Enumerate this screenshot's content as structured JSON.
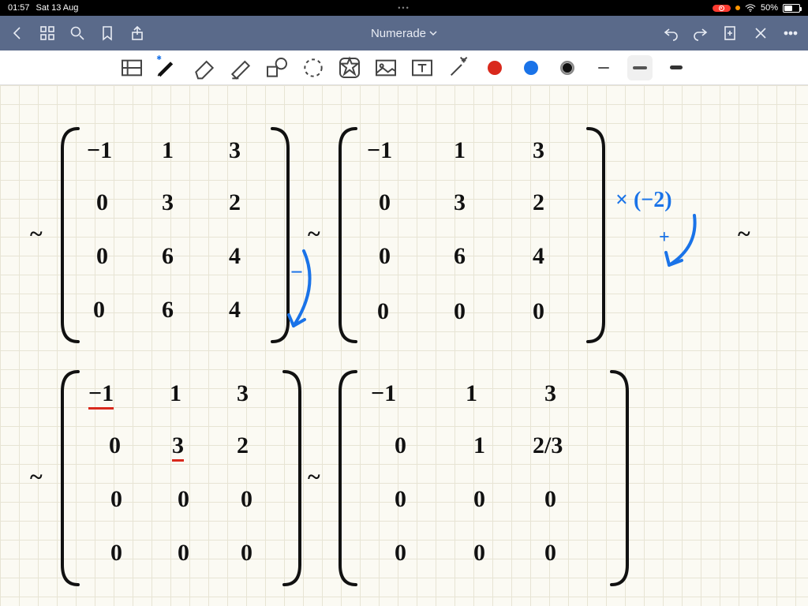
{
  "status": {
    "time": "01:57",
    "date": "Sat 13 Aug",
    "battery_pct": "50%"
  },
  "nav": {
    "title": "Numerade"
  },
  "colors": {
    "red": "#d9291c",
    "blue": "#1a73e8",
    "black": "#111111"
  },
  "work": {
    "tilde": "~",
    "annot1_op": "−",
    "annot2_mult": "× (−2)",
    "annot2_plus": "+",
    "matrix1": [
      [
        "−1",
        "1",
        "3"
      ],
      [
        "0",
        "3",
        "2"
      ],
      [
        "0",
        "6",
        "4"
      ],
      [
        "0",
        "6",
        "4"
      ]
    ],
    "matrix2": [
      [
        "−1",
        "1",
        "3"
      ],
      [
        "0",
        "3",
        "2"
      ],
      [
        "0",
        "6",
        "4"
      ],
      [
        "0",
        "0",
        "0"
      ]
    ],
    "matrix3": [
      [
        "−1",
        "1",
        "3"
      ],
      [
        "0",
        "3",
        "2"
      ],
      [
        "0",
        "0",
        "0"
      ],
      [
        "0",
        "0",
        "0"
      ]
    ],
    "matrix4": [
      [
        "−1",
        "1",
        "3"
      ],
      [
        "0",
        "1",
        "2/3"
      ],
      [
        "0",
        "0",
        "0"
      ],
      [
        "0",
        "0",
        "0"
      ]
    ],
    "pivot_marks": {
      "m3": [
        [
          0,
          0
        ],
        [
          1,
          1
        ]
      ]
    }
  }
}
